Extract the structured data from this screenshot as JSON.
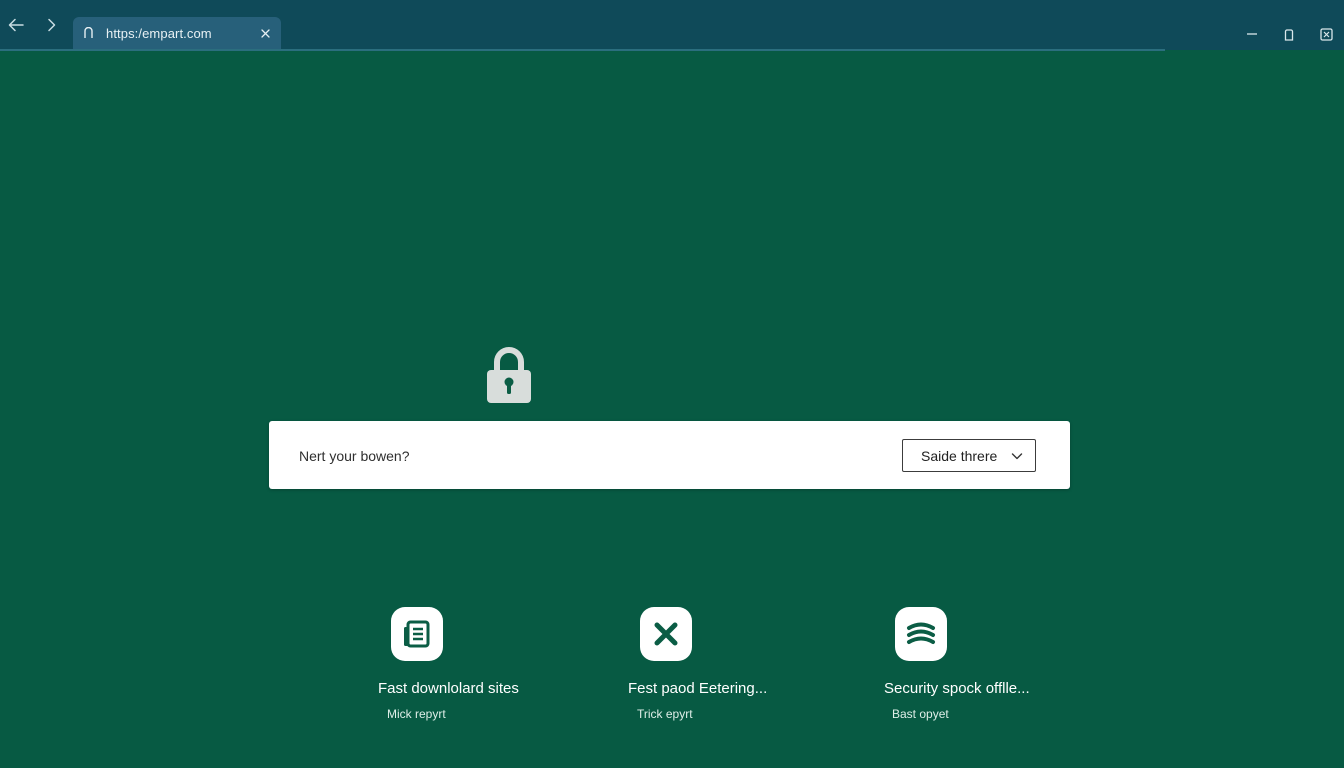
{
  "browser": {
    "tab": {
      "url": "https:/empart.com",
      "site_icon": "page-icon",
      "close_icon": "close-icon"
    },
    "nav": {
      "back_icon": "arrow-left-icon",
      "forward_icon": "arrow-right-icon"
    },
    "window_controls": {
      "minimize_icon": "minimize-icon",
      "maximize_icon": "maximize-icon",
      "close_icon": "close-window-icon"
    }
  },
  "main": {
    "lock_icon": "lock-icon",
    "search": {
      "placeholder": "Nert your bowen?",
      "select_label": "Saide threre",
      "select_icon": "chevron-down-icon"
    },
    "features": [
      {
        "icon": "document-icon",
        "title": "Fast downlolard sites",
        "subtitle": "Mick repyrt"
      },
      {
        "icon": "x-icon",
        "title": "Fest paod Eetering...",
        "subtitle": "Trick epyrt"
      },
      {
        "icon": "waves-icon",
        "title": "Security spock offlle...",
        "subtitle": "Bast opyet"
      }
    ]
  },
  "colors": {
    "background": "#075a43",
    "topbar": "#0f4a59",
    "tab": "#27607a",
    "icon_accent": "#0b5d45",
    "card": "#ffffff"
  }
}
